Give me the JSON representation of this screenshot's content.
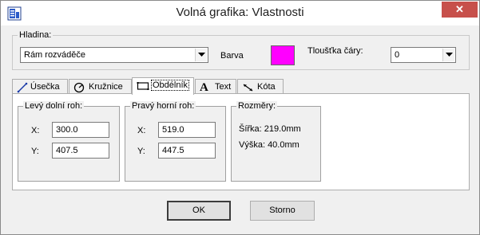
{
  "window": {
    "title": "Volná grafika: Vlastnosti",
    "close_glyph": "✕",
    "close_color": "#c7504b"
  },
  "layer_group": {
    "label": "Hladina:",
    "layer_value": "Rám rozváděče",
    "color_label": "Barva",
    "color_value": "#ff00ff",
    "line_width_label": "Tloušťka čáry:",
    "line_width_value": "0"
  },
  "tabs": [
    {
      "label": "Úsečka",
      "icon": "line-icon"
    },
    {
      "label": "Kružnice",
      "icon": "circle-icon"
    },
    {
      "label": "Obdélník",
      "icon": "rectangle-icon"
    },
    {
      "label": "Text",
      "icon": "text-icon"
    },
    {
      "label": "Kóta",
      "icon": "dimension-icon"
    }
  ],
  "active_tab": "Obdélník",
  "rect_tab": {
    "lower_left": {
      "label": "Levý dolní roh:",
      "x_label": "X:",
      "x_value": "300.0",
      "y_label": "Y:",
      "y_value": "407.5"
    },
    "upper_right": {
      "label": "Pravý horní roh:",
      "x_label": "X:",
      "x_value": "519.0",
      "y_label": "Y:",
      "y_value": "447.5"
    },
    "dimensions": {
      "label": "Rozměry:",
      "width_text": "Šířka: 219.0mm",
      "height_text": "Výška: 40.0mm"
    }
  },
  "buttons": {
    "ok": "OK",
    "cancel": "Storno"
  }
}
